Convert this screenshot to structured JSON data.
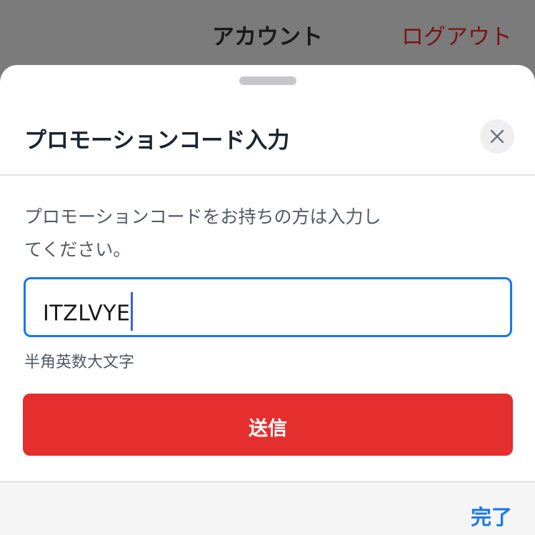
{
  "header": {
    "title": "アカウント",
    "logout_label": "ログアウト"
  },
  "sheet": {
    "title": "プロモーションコード入力",
    "close_icon": "close-icon",
    "description_line1": "プロモーションコードをお持ちの方は入力し",
    "description_line2": "てください。",
    "input": {
      "value": "ITZLVYE"
    },
    "hint": "半角英数大文字",
    "submit_label": "送信"
  },
  "keyboard_toolbar": {
    "done_label": "完了"
  },
  "colors": {
    "accent_blue": "#1677f0",
    "submit_red": "#e52e2e",
    "done_blue": "#1b7ae8"
  }
}
